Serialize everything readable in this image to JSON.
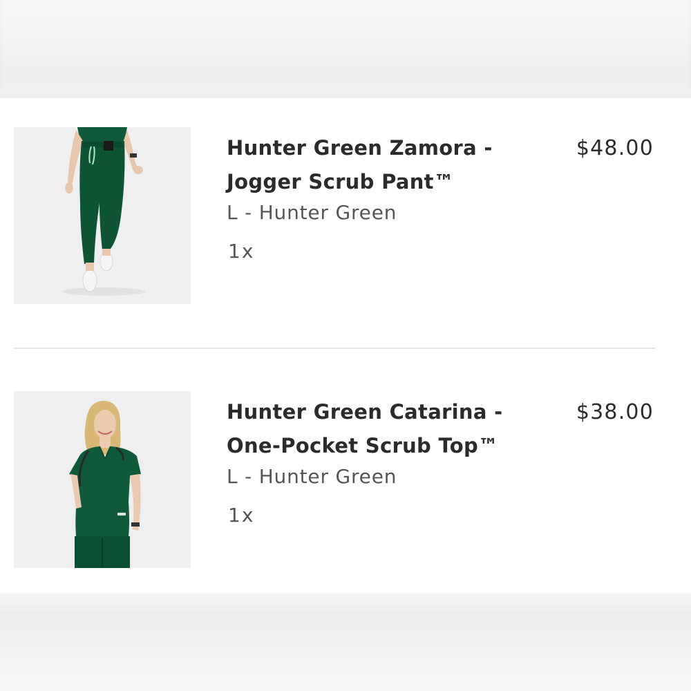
{
  "cart": {
    "items": [
      {
        "title_line1": "Hunter Green Zamora -",
        "title_line2": "Jogger Scrub Pant™",
        "variant": "L - Hunter Green",
        "quantity": "1x",
        "price": "$48.00",
        "image_icon": "jogger-pant-photo"
      },
      {
        "title_line1": "Hunter Green Catarina -",
        "title_line2": "One-Pocket Scrub Top™",
        "variant": "L - Hunter Green",
        "quantity": "1x",
        "price": "$38.00",
        "image_icon": "scrub-top-photo"
      }
    ]
  },
  "colors": {
    "text_primary": "#2b2b2b",
    "text_secondary": "#555555",
    "hunter_green": "#0f5a3a",
    "divider": "#e6e6e6"
  }
}
